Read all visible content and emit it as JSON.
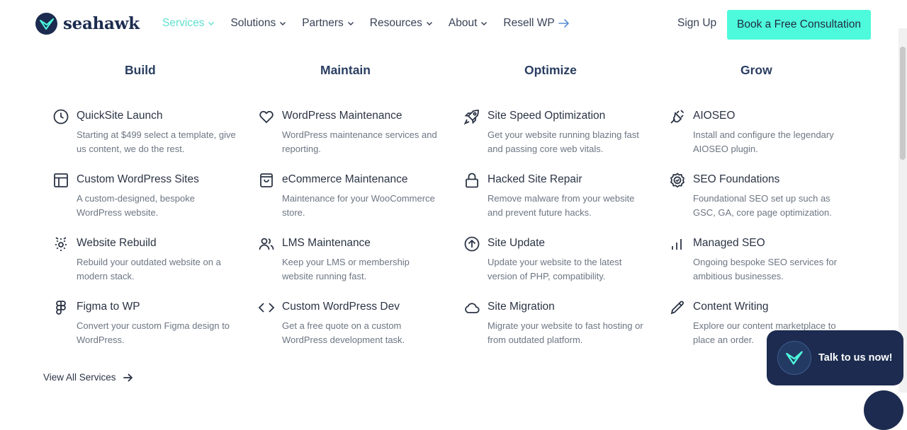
{
  "brand": {
    "name": "seahawk",
    "color": "#1c2b4f",
    "accent": "#4dfadc"
  },
  "nav": {
    "items": [
      {
        "label": "Services",
        "active": true,
        "icon": "chevron-down-icon"
      },
      {
        "label": "Solutions",
        "active": false,
        "icon": "chevron-down-icon"
      },
      {
        "label": "Partners",
        "active": false,
        "icon": "chevron-down-icon"
      },
      {
        "label": "Resources",
        "active": false,
        "icon": "chevron-down-icon"
      },
      {
        "label": "About",
        "active": false,
        "icon": "chevron-down-icon"
      },
      {
        "label": "Resell WP",
        "active": false,
        "icon": "arrow-right-icon"
      }
    ],
    "signup": "Sign Up",
    "cta": "Book a Free Consultation"
  },
  "columns": [
    {
      "heading": "Build",
      "services": [
        {
          "icon": "clock-icon",
          "title": "QuickSite Launch",
          "desc": "Starting at $499 select a template, give us content, we do the rest."
        },
        {
          "icon": "layout-icon",
          "title": "Custom WordPress Sites",
          "desc": "A custom-designed, bespoke WordPress website."
        },
        {
          "icon": "gear-rebuild-icon",
          "title": "Website Rebuild",
          "desc": "Rebuild your outdated website on a modern stack."
        },
        {
          "icon": "figma-icon",
          "title": "Figma to WP",
          "desc": "Convert your custom Figma design to WordPress."
        }
      ]
    },
    {
      "heading": "Maintain",
      "services": [
        {
          "icon": "heart-icon",
          "title": "WordPress Maintenance",
          "desc": "WordPress maintenance services and reporting."
        },
        {
          "icon": "shopping-bag-icon",
          "title": "eCommerce Maintenance",
          "desc": "Maintenance for your WooCommerce store."
        },
        {
          "icon": "users-icon",
          "title": "LMS Maintenance",
          "desc": "Keep your LMS or membership website running fast."
        },
        {
          "icon": "code-icon",
          "title": "Custom WordPress Dev",
          "desc": "Get a free quote on a custom WordPress development task."
        }
      ]
    },
    {
      "heading": "Optimize",
      "services": [
        {
          "icon": "rocket-icon",
          "title": "Site Speed Optimization",
          "desc": "Get your website running blazing fast and passing core web vitals."
        },
        {
          "icon": "lock-icon",
          "title": "Hacked Site Repair",
          "desc": "Remove malware from your website and prevent future hacks."
        },
        {
          "icon": "arrow-up-circle-icon",
          "title": "Site Update",
          "desc": "Update your website to the latest version of PHP, compatibility."
        },
        {
          "icon": "cloud-icon",
          "title": "Site Migration",
          "desc": "Migrate your website to fast hosting or from outdated platform."
        }
      ]
    },
    {
      "heading": "Grow",
      "services": [
        {
          "icon": "plug-icon",
          "title": "AIOSEO",
          "desc": "Install and configure the legendary AIOSEO plugin."
        },
        {
          "icon": "badge-check-icon",
          "title": "SEO Foundations",
          "desc": "Foundational SEO set up such as GSC, GA, core page optimization."
        },
        {
          "icon": "bar-chart-icon",
          "title": "Managed SEO",
          "desc": "Ongoing bespoke SEO services for ambitious businesses."
        },
        {
          "icon": "pencil-icon",
          "title": "Content Writing",
          "desc": "Explore our content marketplace to place an order."
        }
      ]
    }
  ],
  "view_all": "View All Services",
  "chat": {
    "label": "Talk to us now!"
  }
}
